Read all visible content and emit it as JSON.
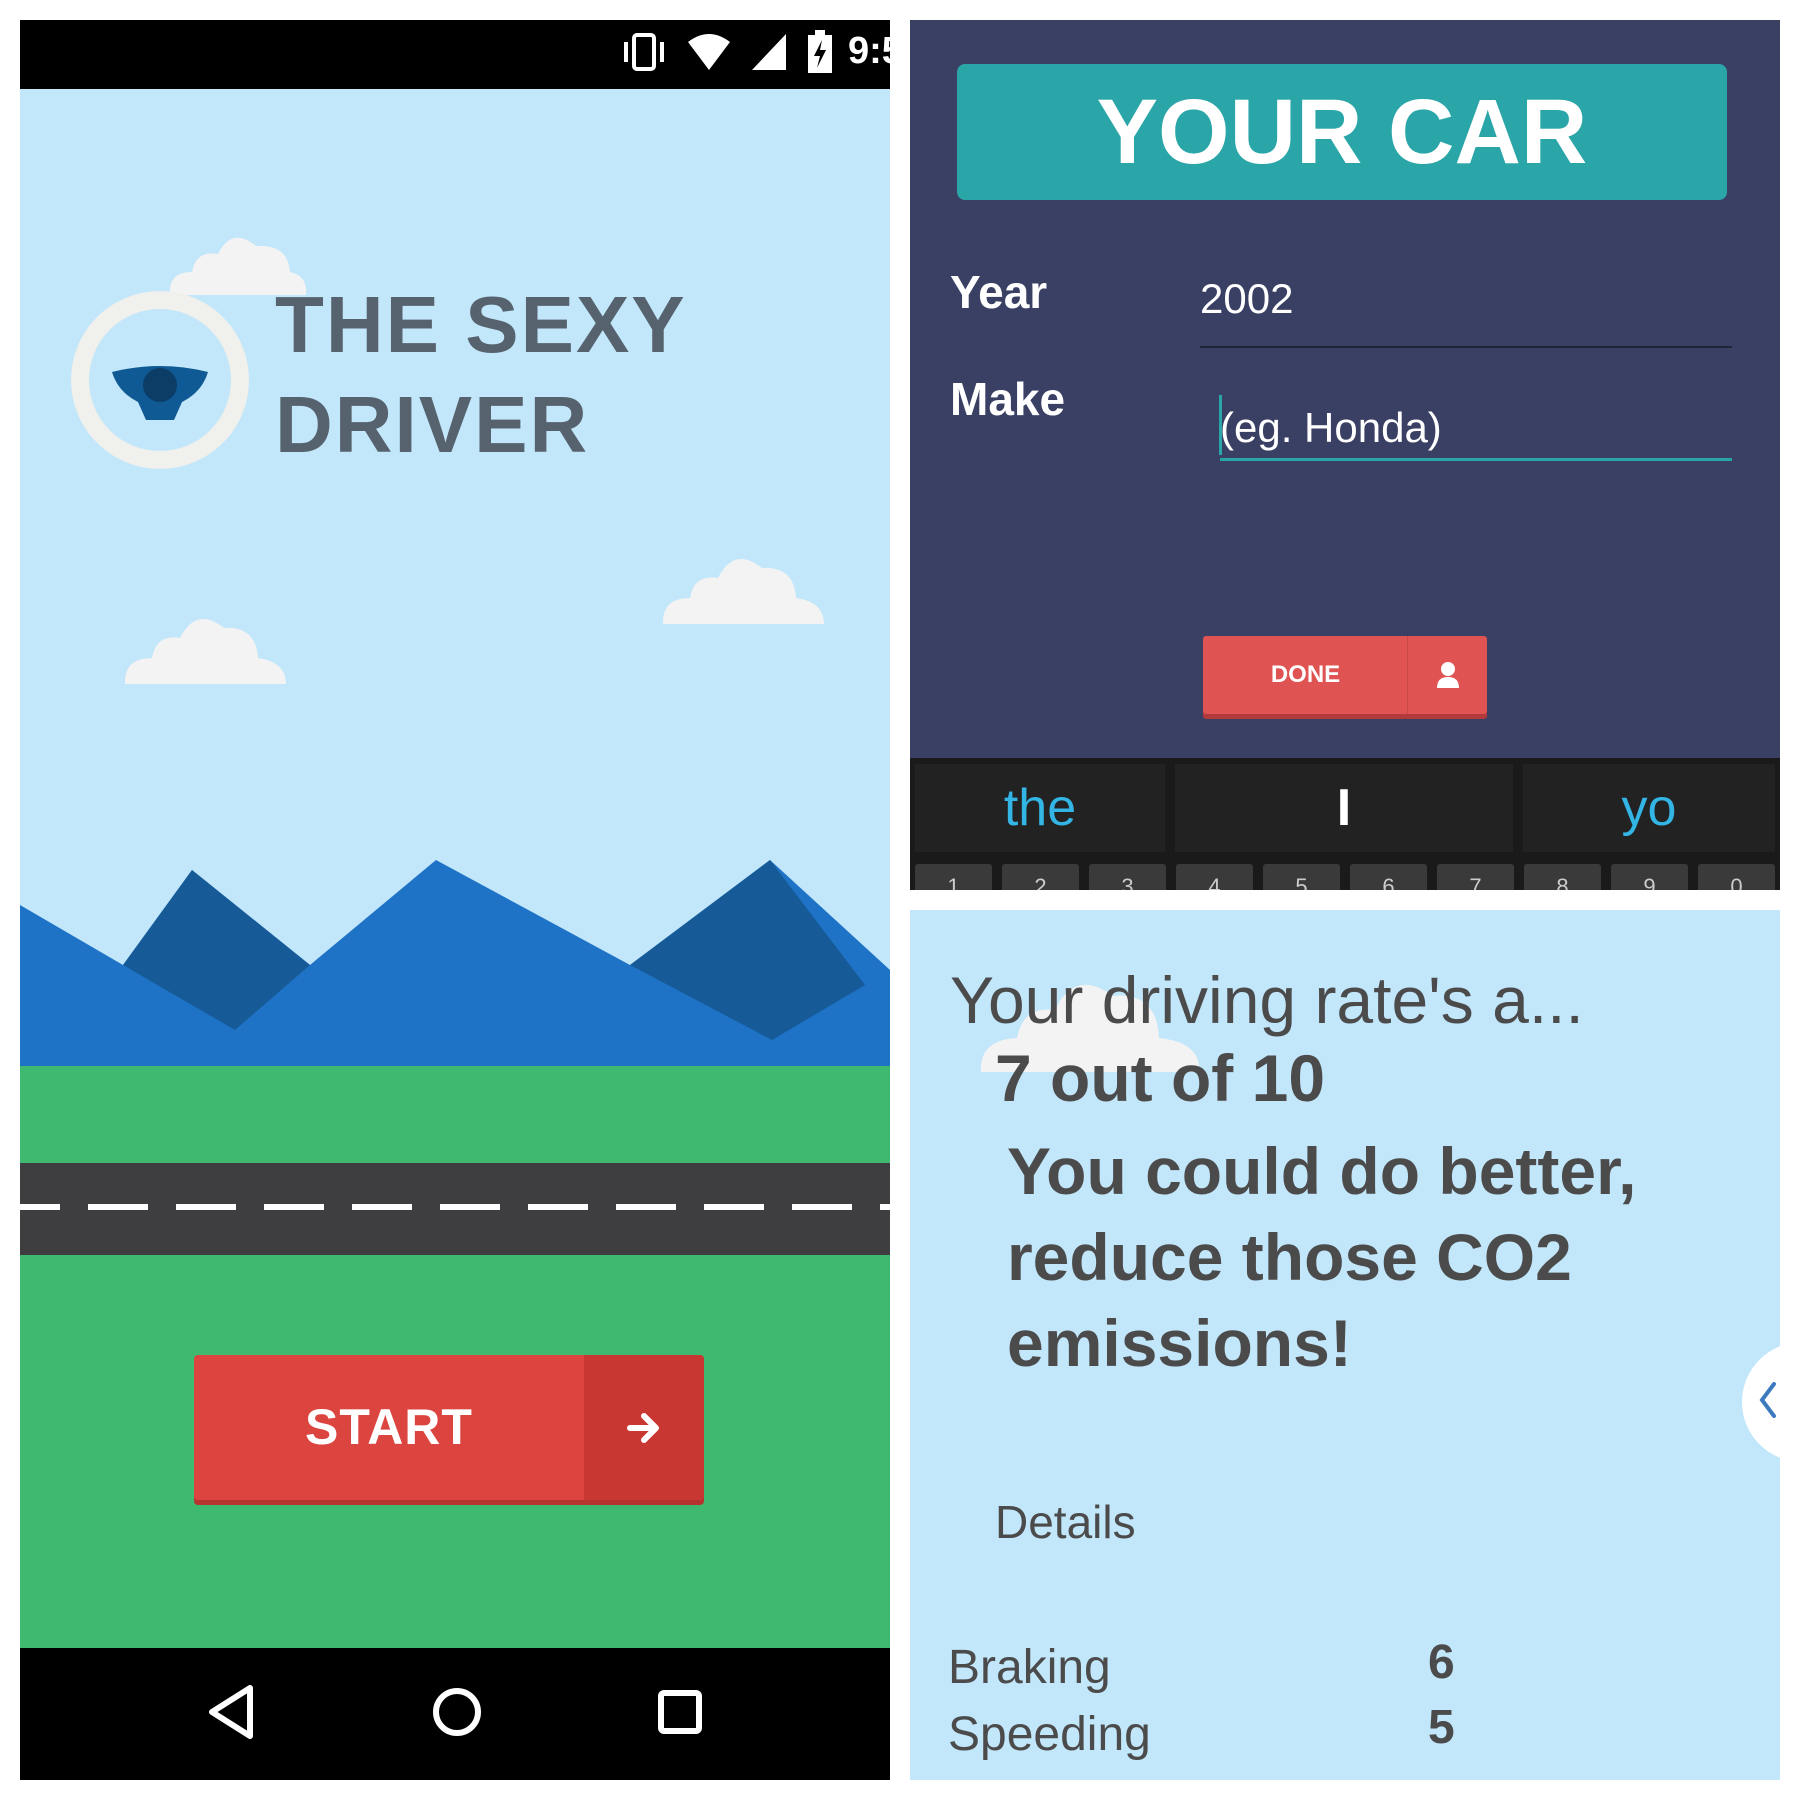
{
  "left_screen": {
    "status_bar": {
      "time": "9:5",
      "icons": [
        "vibrate-icon",
        "wifi-icon",
        "cell-signal-icon",
        "battery-charging-icon"
      ]
    },
    "app_title": "THE SEXY DRIVER",
    "start_button": {
      "label": "START",
      "icon": "arrow-right-icon"
    },
    "nav_bar": {
      "icons": [
        "back-icon",
        "home-icon",
        "recents-icon"
      ]
    }
  },
  "car_screen": {
    "header": "YOUR CAR",
    "year": {
      "label": "Year",
      "value": "2002"
    },
    "make": {
      "label": "Make",
      "placeholder": "(eg. Honda)"
    },
    "done_button": {
      "label": "DONE",
      "icon": "person-icon"
    },
    "keyboard": {
      "suggestions": [
        "the",
        "I",
        "yo"
      ],
      "number_keys": [
        "1",
        "2",
        "3",
        "4",
        "5",
        "6",
        "7",
        "8",
        "9",
        "0"
      ]
    }
  },
  "result_screen": {
    "intro": "Your driving rate's a...",
    "score": "7 out of 10",
    "message": "You could do better, reduce those CO2 emissions!",
    "details_label": "Details",
    "metrics": [
      {
        "name": "Braking",
        "value": "6"
      },
      {
        "name": "Speeding",
        "value": "5"
      }
    ]
  },
  "colors": {
    "sky": "#c2e6fa",
    "teal_header": "#2aa6a9",
    "navy_background": "#3a4064",
    "red_button": "#dc4440",
    "grass": "#3fb96f",
    "road": "#3e3e41"
  }
}
